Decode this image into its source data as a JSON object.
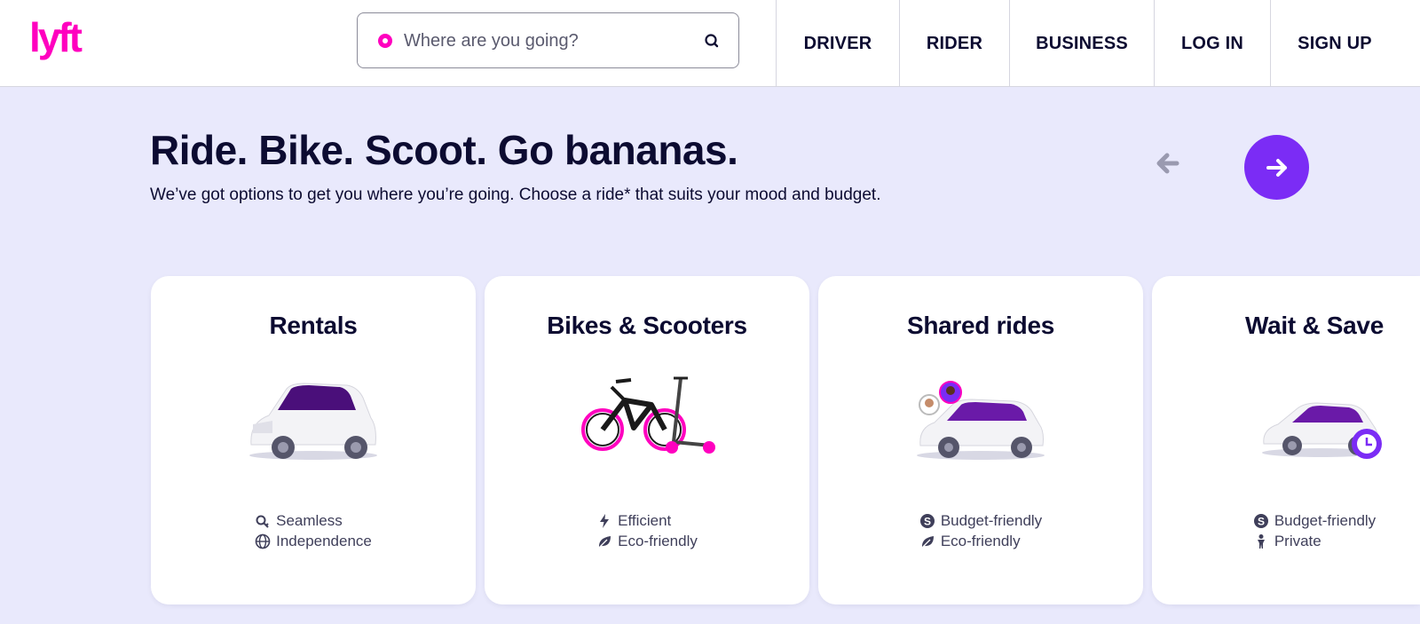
{
  "brand": {
    "logo_text": "lyft",
    "accent": "#ff00bf",
    "purple": "#7b2cf5",
    "background": "#e9e9fc"
  },
  "search": {
    "placeholder": "Where are you going?"
  },
  "nav": {
    "driver": "DRIVER",
    "rider": "RIDER",
    "business": "BUSINESS",
    "login": "LOG IN",
    "signup": "SIGN UP"
  },
  "hero": {
    "title": "Ride. Bike. Scoot. Go bananas.",
    "subtitle": "We’ve got options to get you where you’re going. Choose a ride* that suits your mood and budget."
  },
  "cards": [
    {
      "title": "Rentals",
      "features": [
        {
          "icon": "key-icon",
          "label": "Seamless"
        },
        {
          "icon": "globe-icon",
          "label": "Independence"
        }
      ]
    },
    {
      "title": "Bikes & Scooters",
      "features": [
        {
          "icon": "lightning-icon",
          "label": "Efficient"
        },
        {
          "icon": "leaf-icon",
          "label": "Eco-friendly"
        }
      ]
    },
    {
      "title": "Shared rides",
      "features": [
        {
          "icon": "dollar-icon",
          "label": "Budget-friendly"
        },
        {
          "icon": "leaf-icon",
          "label": "Eco-friendly"
        }
      ]
    },
    {
      "title": "Wait & Save",
      "features": [
        {
          "icon": "dollar-icon",
          "label": "Budget-friendly"
        },
        {
          "icon": "person-icon",
          "label": "Private"
        }
      ]
    }
  ]
}
